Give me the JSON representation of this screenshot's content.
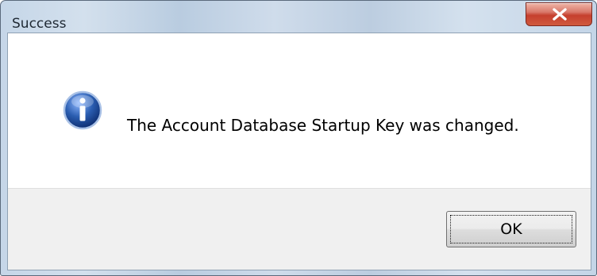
{
  "window": {
    "title": "Success"
  },
  "message": {
    "text": "The Account Database Startup Key was changed.",
    "icon": "information-icon"
  },
  "buttons": {
    "ok_label": "OK",
    "close_icon": "close-icon"
  },
  "colors": {
    "titlebar": "#c5d6e8",
    "close_button": "#c6402e",
    "info_icon": "#2a5db0",
    "footer": "#f0f0f0"
  }
}
